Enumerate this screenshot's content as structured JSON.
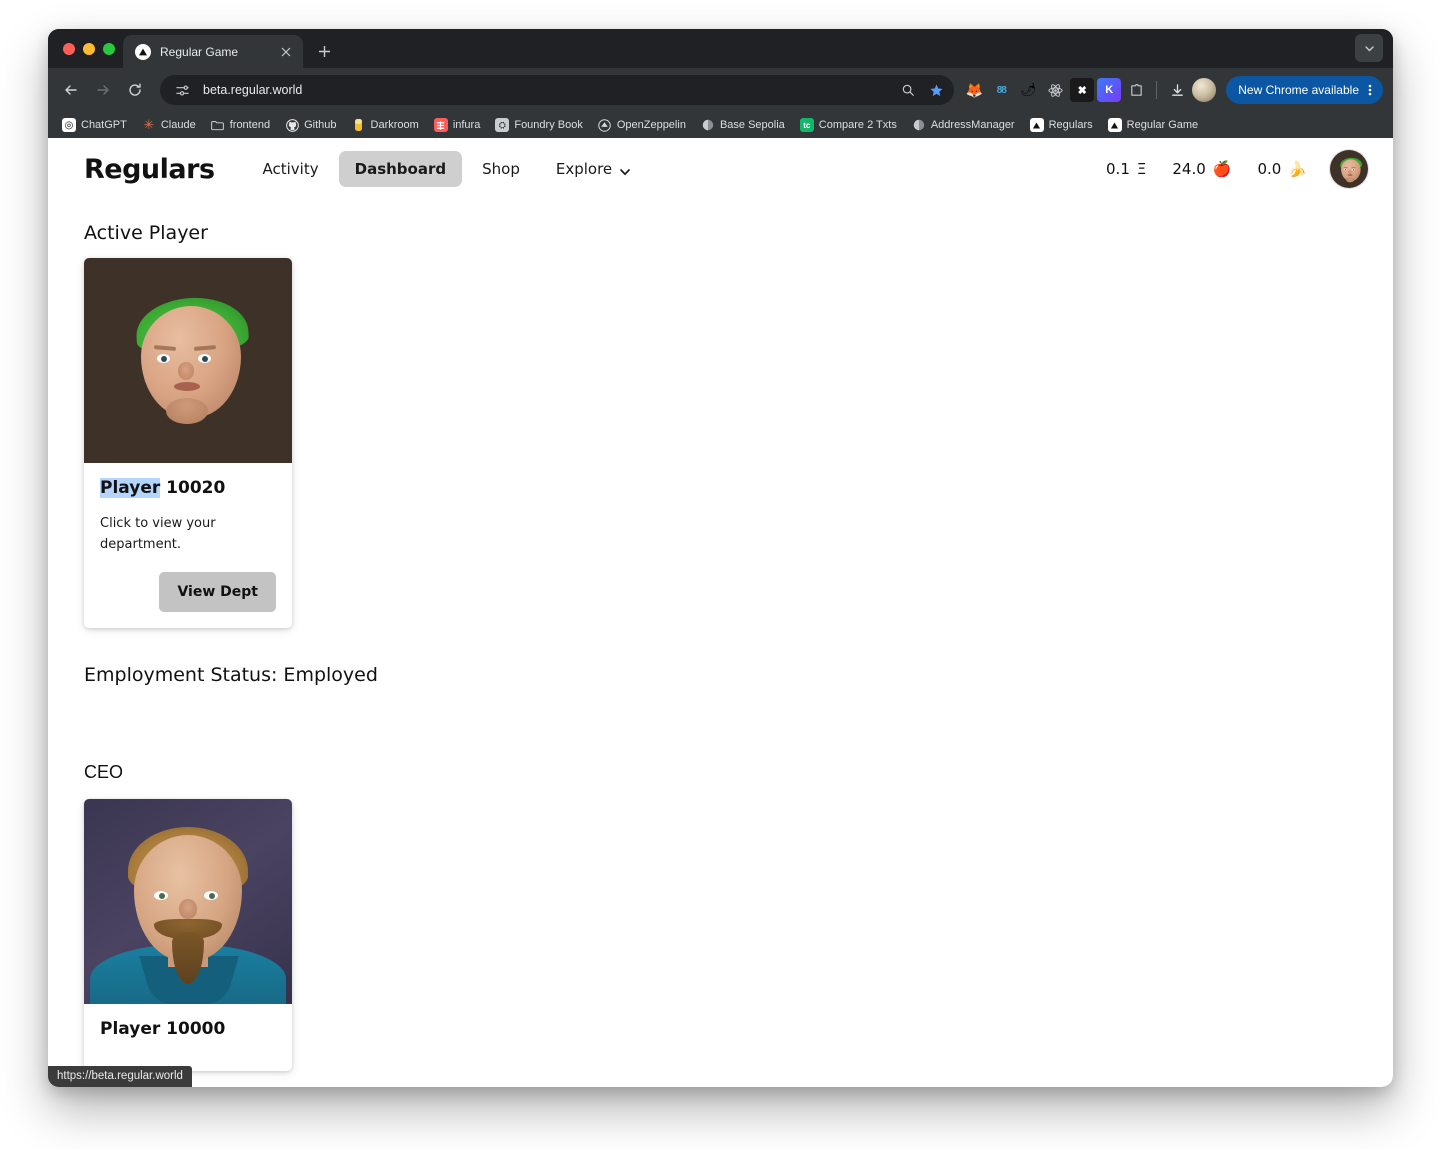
{
  "browser": {
    "tab": {
      "title": "Regular Game",
      "favicon": "triangle-logo-icon",
      "close": "×"
    },
    "new_tab_label": "+",
    "tabstrip_right_icon": "chevron-down-icon",
    "toolbar": {
      "back_icon": "←",
      "forward_icon": "→",
      "reload_icon": "⟳",
      "site_settings_icon": "tune-icon",
      "url": "beta.regular.world",
      "zoom_icon": "🔍",
      "bookmark_icon": "★",
      "extensions": [
        {
          "name": "metamask-extension",
          "glyph": "🦊",
          "bg": "transparent"
        },
        {
          "name": "rabby-extension",
          "glyph": "88",
          "bg": "transparent",
          "color": "#4aa8e0"
        },
        {
          "name": "sushi-extension",
          "glyph": "🌶",
          "bg": "transparent"
        },
        {
          "name": "react-devtools-extension",
          "glyph": "⚛",
          "bg": "transparent"
        },
        {
          "name": "x-extension",
          "glyph": "✖",
          "bg": "#1a1a1a"
        },
        {
          "name": "kiwi-extension",
          "glyph": "K",
          "bg": "#2f7bf6"
        },
        {
          "name": "extensions-puzzle-icon",
          "glyph": "🧩",
          "bg": "transparent"
        }
      ],
      "downloads_icon": "⤓",
      "profile_icon": "profile-avatar",
      "update_label": "New Chrome available",
      "update_menu_icon": "⋮",
      "update_bg": "#0b57a4"
    },
    "bookmarks": [
      {
        "label": "ChatGPT",
        "glyph": "◎",
        "bg": "#ffffff",
        "color": "#111111"
      },
      {
        "label": "Claude",
        "glyph": "✳",
        "bg": "transparent",
        "color": "#d97757"
      },
      {
        "label": "frontend",
        "glyph": "🗀",
        "bg": "transparent",
        "color": "#d6d9dc"
      },
      {
        "label": "Github",
        "glyph": "",
        "bg": "transparent",
        "color": "#e6e6e6"
      },
      {
        "label": "Darkroom",
        "glyph": "▮",
        "bg": "transparent",
        "color": "#f2c029"
      },
      {
        "label": "infura",
        "glyph": "≡",
        "bg": "#ff5b5b",
        "color": "#ffffff"
      },
      {
        "label": "Foundry Book",
        "glyph": "⛭",
        "bg": "#c9ccd0",
        "color": "#222222"
      },
      {
        "label": "OpenZeppelin",
        "glyph": "◍",
        "bg": "transparent",
        "color": "#d6d9dc"
      },
      {
        "label": "Base Sepolia",
        "glyph": "◖",
        "bg": "transparent",
        "color": "#b9bec3"
      },
      {
        "label": "Compare 2 Txts",
        "glyph": "tc",
        "bg": "#12b76a",
        "color": "#ffffff"
      },
      {
        "label": "AddressManager",
        "glyph": "◖",
        "bg": "transparent",
        "color": "#b9bec3"
      },
      {
        "label": "Regulars",
        "glyph": "▲",
        "bg": "#ffffff",
        "color": "#111111"
      },
      {
        "label": "Regular Game",
        "glyph": "▲",
        "bg": "#ffffff",
        "color": "#111111"
      }
    ],
    "status_bubble": "https://beta.regular.world"
  },
  "app": {
    "brand": "Regulars",
    "nav": [
      {
        "label": "Activity",
        "active": false,
        "has_chevron": false
      },
      {
        "label": "Dashboard",
        "active": true,
        "has_chevron": false
      },
      {
        "label": "Shop",
        "active": false,
        "has_chevron": false
      },
      {
        "label": "Explore",
        "active": false,
        "has_chevron": true
      }
    ],
    "stats": [
      {
        "name": "eth-balance",
        "value": "0.1",
        "glyph": "Ξ"
      },
      {
        "name": "apple-balance",
        "value": "24.0",
        "glyph": "🍎"
      },
      {
        "name": "banana-balance",
        "value": "0.0",
        "glyph": "🍌"
      }
    ],
    "avatar_alt": "player-avatar",
    "sections": {
      "active_player_title": "Active Player",
      "employment_status": "Employment Status: Employed",
      "ceo_title": "CEO"
    },
    "player_card": {
      "name_prefix": "Player",
      "name_number": "10020",
      "description": "Click to view your department.",
      "button_label": "View Dept",
      "image_alt": "player-10020-portrait"
    },
    "ceo_card": {
      "name_prefix": "Player",
      "name_number": "10000",
      "image_alt": "player-10000-portrait"
    }
  }
}
